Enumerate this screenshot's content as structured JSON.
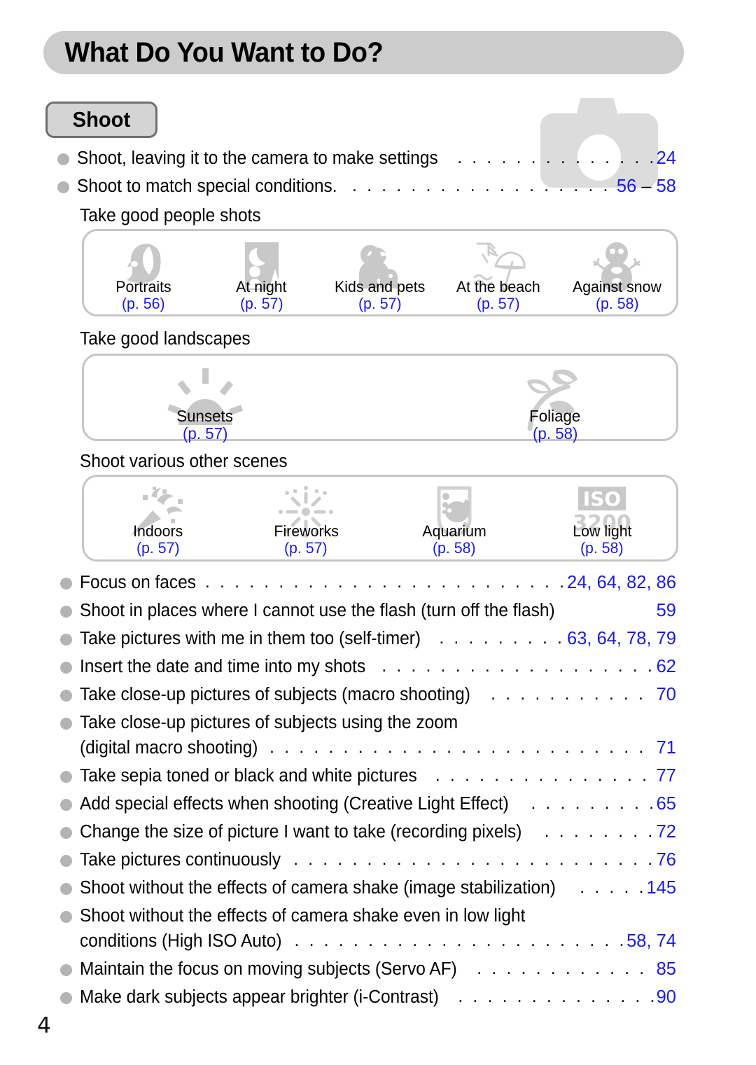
{
  "page": {
    "title": "What Do You Want to Do?",
    "number": "4",
    "accent_blue": "#1818f0",
    "bar_gray": "#cccccc",
    "icon_gray": "#c8c8c8"
  },
  "section": {
    "badge": "Shoot",
    "watermark_icon": "camera-icon"
  },
  "top_entries": [
    {
      "label": "Shoot, leaving it to the camera to make settings",
      "pages": "24"
    },
    {
      "label": "Shoot to match special conditions.",
      "pages_parts": [
        "56",
        " – ",
        "58"
      ]
    }
  ],
  "groups": [
    {
      "heading": "Take good people shots",
      "items": [
        {
          "name": "Portraits",
          "page": "(p. 56)",
          "icon": "portrait-icon"
        },
        {
          "name": "At night",
          "page": "(p. 57)",
          "icon": "night-icon"
        },
        {
          "name": "Kids and pets",
          "page": "(p. 57)",
          "icon": "kids-and-pets-icon"
        },
        {
          "name": "At the beach",
          "page": "(p. 57)",
          "icon": "beach-icon"
        },
        {
          "name": "Against snow",
          "page": "(p. 58)",
          "icon": "snow-icon"
        }
      ]
    },
    {
      "heading": "Take good landscapes",
      "items": [
        {
          "name": "Sunsets",
          "page": "(p. 57)",
          "icon": "sunset-icon"
        },
        {
          "name": "Foliage",
          "page": "(p. 58)",
          "icon": "foliage-icon"
        }
      ]
    },
    {
      "heading": "Shoot various other scenes",
      "items": [
        {
          "name": "Indoors",
          "page": "(p. 57)",
          "icon": "indoors-icon"
        },
        {
          "name": "Fireworks",
          "page": "(p. 57)",
          "icon": "fireworks-icon"
        },
        {
          "name": "Aquarium",
          "page": "(p. 58)",
          "icon": "aquarium-icon"
        },
        {
          "name": "Low light",
          "page": "(p. 58)",
          "icon": "iso-3200-icon"
        }
      ]
    }
  ],
  "iso_icon": {
    "label": "ISO",
    "value": "3200"
  },
  "bottom_entries": [
    {
      "label": "Focus on faces",
      "pages": "24, 64, 82, 86"
    },
    {
      "label": "Shoot in places where I cannot use the flash (turn off the flash)",
      "pages": "59",
      "no_leader": true
    },
    {
      "label": "Take pictures with me in them too (self-timer)",
      "pages": "63, 64, 78, 79"
    },
    {
      "label": "Insert the date and time into my shots",
      "pages": "62"
    },
    {
      "label": "Take close-up pictures of subjects (macro shooting)",
      "pages": "70"
    },
    {
      "label": "Take close-up pictures of subjects using the zoom",
      "pages": "",
      "no_leader": true
    },
    {
      "label": "(digital macro shooting)",
      "pages": "71",
      "continuation": true
    },
    {
      "label": "Take sepia toned or black and white pictures",
      "pages": "77"
    },
    {
      "label": "Add special effects when shooting (Creative Light Effect)",
      "pages": "65"
    },
    {
      "label": "Change the size of picture I want to take (recording pixels)",
      "pages": "72"
    },
    {
      "label": "Take pictures continuously",
      "pages": "76"
    },
    {
      "label": "Shoot without the effects of camera shake (image stabilization)",
      "pages": "145"
    },
    {
      "label": "Shoot without the effects of camera shake even in low light",
      "pages": "",
      "no_leader": true
    },
    {
      "label": "conditions (High ISO Auto)",
      "pages": "58, 74",
      "continuation": true
    },
    {
      "label": "Maintain the focus on moving subjects (Servo AF)",
      "pages": "85"
    },
    {
      "label": "Make dark subjects appear brighter (i-Contrast)",
      "pages": "90"
    }
  ]
}
